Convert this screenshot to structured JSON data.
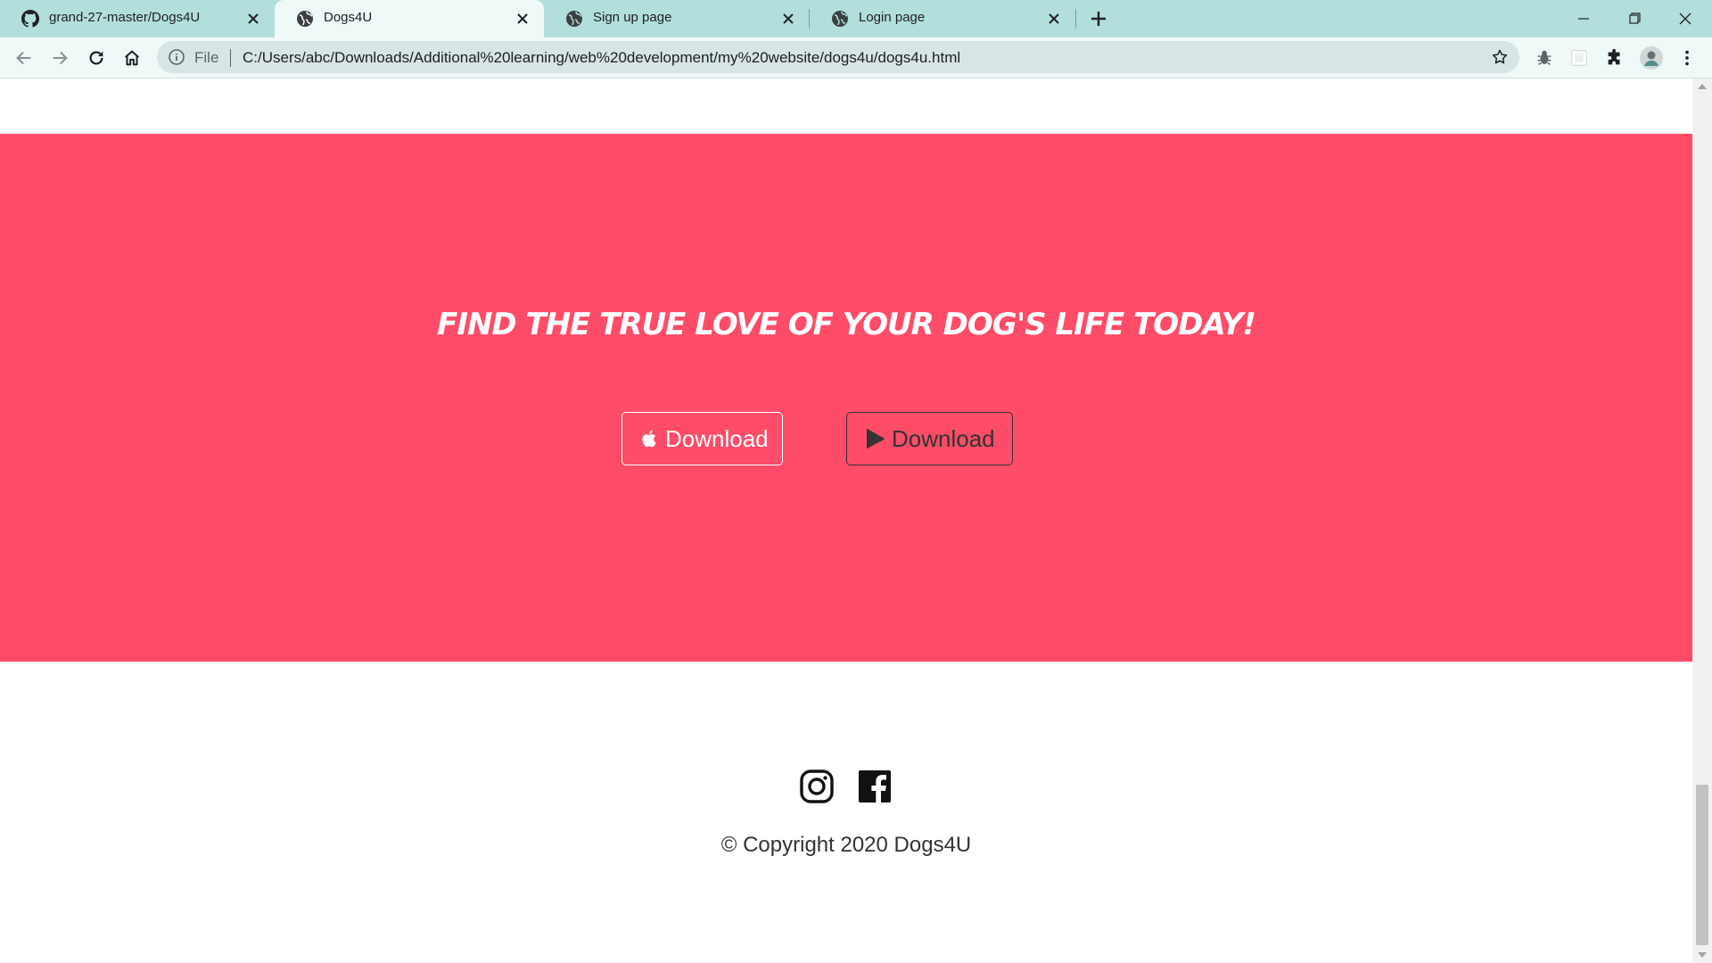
{
  "browser": {
    "tabs": [
      {
        "title": "grand-27-master/Dogs4U",
        "icon": "github-icon"
      },
      {
        "title": "Dogs4U",
        "icon": "globe-icon",
        "active": true
      },
      {
        "title": "Sign up page",
        "icon": "globe-icon"
      },
      {
        "title": "Login page",
        "icon": "globe-icon"
      }
    ],
    "omnibox": {
      "scheme_label": "File",
      "url": "C:/Users/abc/Downloads/Additional%20learning/web%20development/my%20website/dogs4u/dogs4u.html"
    }
  },
  "page": {
    "cta_heading": "Find the true love of your dog's life today!",
    "buttons": [
      {
        "label": "Download",
        "icon": "apple-icon"
      },
      {
        "label": "Download",
        "icon": "google-play-icon"
      }
    ],
    "social": [
      "instagram-icon",
      "facebook-icon"
    ],
    "copyright": "© Copyright 2020 Dogs4U"
  },
  "colors": {
    "tabstrip_bg": "#b2dfdb",
    "cta_bg": "#ff4c68",
    "text_dark": "#333333"
  }
}
